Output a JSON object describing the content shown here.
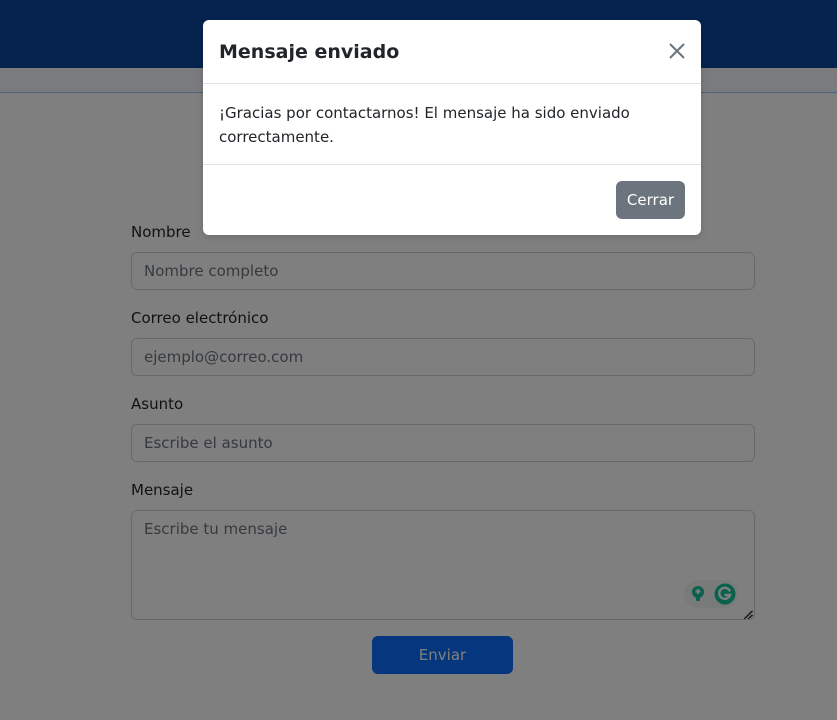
{
  "form": {
    "name_label": "Nombre",
    "name_placeholder": "Nombre completo",
    "email_label": "Correo electrónico",
    "email_placeholder": "ejemplo@correo.com",
    "subject_label": "Asunto",
    "subject_placeholder": "Escribe el asunto",
    "message_label": "Mensaje",
    "message_placeholder": "Escribe tu mensaje",
    "submit_label": "Enviar"
  },
  "modal": {
    "title": "Mensaje enviado",
    "body": "¡Gracias por contactarnos! El mensaje ha sido enviado correctamente.",
    "close_label": "Cerrar",
    "close_icon": "close-icon"
  },
  "colors": {
    "header": "#0d47a1",
    "primary": "#0d6efd",
    "secondary": "#6c757d"
  },
  "icons": {
    "grammarly": [
      "lightbulb-icon",
      "grammarly-logo-icon"
    ],
    "textarea_resize": "resize-grip-icon"
  }
}
